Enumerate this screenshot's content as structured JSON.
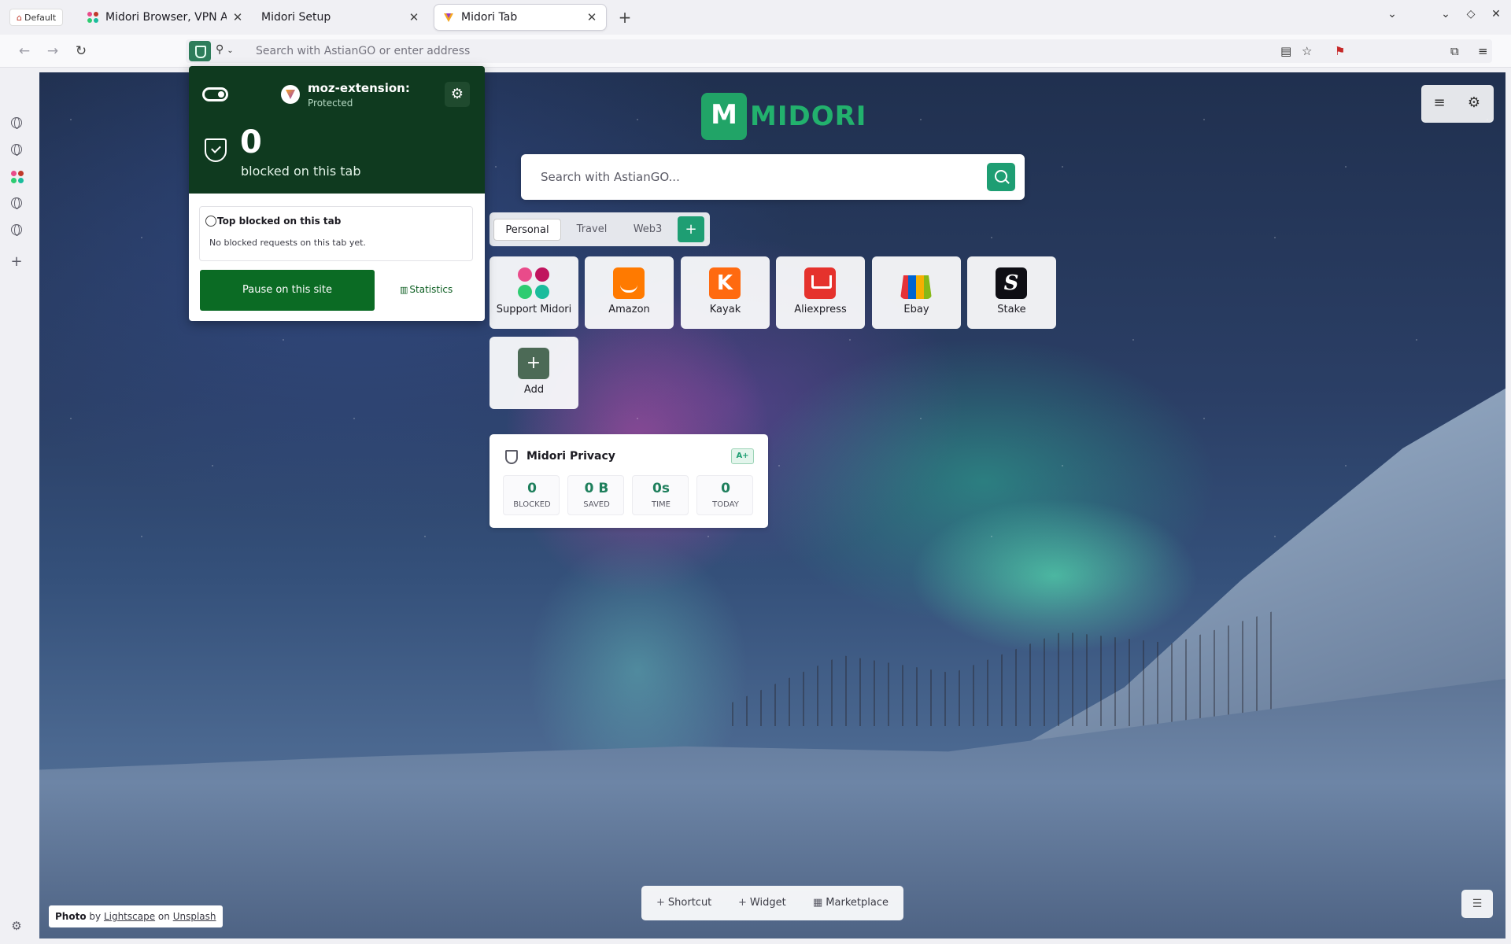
{
  "browser": {
    "profile_label": "Default",
    "tabs": [
      {
        "title": "Midori Browser, VPN And P"
      },
      {
        "title": "Midori Setup"
      },
      {
        "title": "Midori Tab"
      }
    ],
    "url_placeholder": "Search with AstianGO or enter address"
  },
  "extension_popup": {
    "site_name": "moz-extension:",
    "site_status": "Protected",
    "blocked_count": "0",
    "blocked_label": "blocked on this tab",
    "top_blocked_title": "Top blocked on this tab",
    "top_blocked_empty": "No blocked requests on this tab yet.",
    "pause_label": "Pause on this site",
    "statistics_label": "Statistics",
    "accent": "#0f3a1f"
  },
  "start_page": {
    "logo_text": "MIDORI",
    "search_placeholder": "Search with AstianGO...",
    "categories": [
      {
        "label": "Personal",
        "active": true
      },
      {
        "label": "Travel",
        "active": false
      },
      {
        "label": "Web3",
        "active": false
      }
    ],
    "shortcuts": [
      {
        "label": "Support Midori",
        "icon": "midori-dots-icon"
      },
      {
        "label": "Amazon",
        "icon": "amazon-icon"
      },
      {
        "label": "Kayak",
        "icon": "kayak-icon"
      },
      {
        "label": "Aliexpress",
        "icon": "aliexpress-icon"
      },
      {
        "label": "Ebay",
        "icon": "ebay-icon"
      },
      {
        "label": "Stake",
        "icon": "stake-icon"
      },
      {
        "label": "Add",
        "icon": "plus-icon"
      }
    ],
    "kayak_letter": "K",
    "stake_letter": "S",
    "privacy": {
      "title": "Midori Privacy",
      "grade": "A+",
      "stats": [
        {
          "value": "0",
          "label": "BLOCKED"
        },
        {
          "value": "0 B",
          "label": "SAVED"
        },
        {
          "value": "0s",
          "label": "TIME"
        },
        {
          "value": "0",
          "label": "TODAY"
        }
      ]
    },
    "bottom_bar": {
      "shortcut": "Shortcut",
      "widget": "Widget",
      "marketplace": "Marketplace"
    },
    "credit": {
      "photo": "Photo",
      "by": "by",
      "author": "Lightscape",
      "on": "on",
      "source": "Unsplash"
    },
    "brand_color": "#21a467"
  }
}
